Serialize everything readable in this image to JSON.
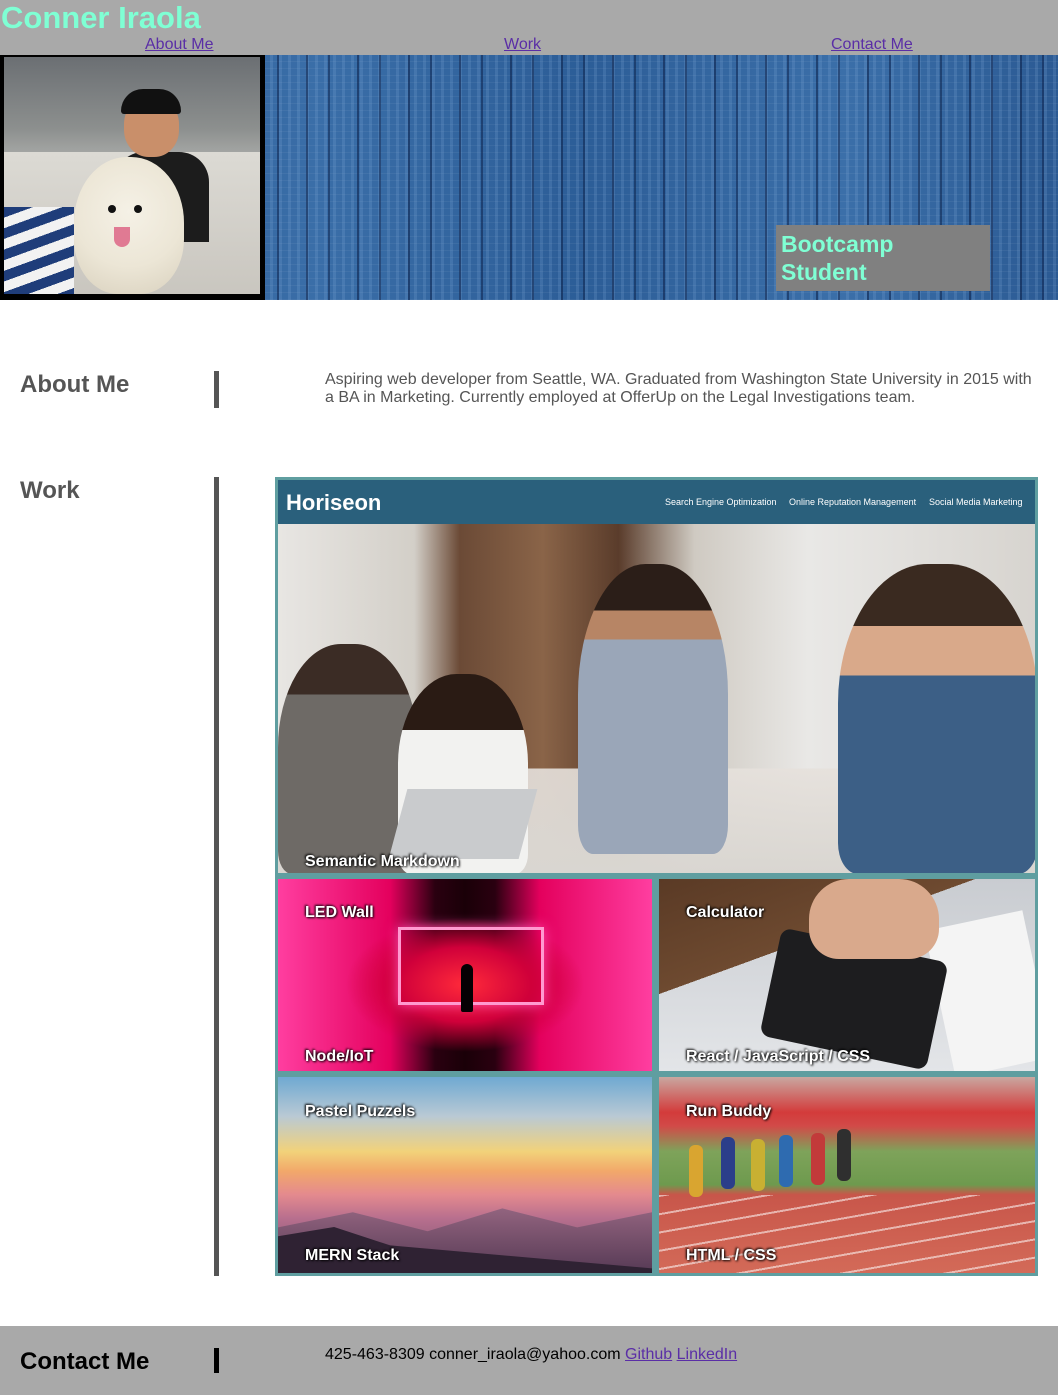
{
  "header": {
    "title": "Conner Iraola",
    "nav": [
      "About Me",
      "Work",
      "Contact Me"
    ],
    "title_color": "#7fffd4",
    "background": "#a9a9a9"
  },
  "hero": {
    "tagline": "Bootcamp Student",
    "tagline_color": "#7fffd4"
  },
  "about": {
    "heading": "About Me",
    "text": "Aspiring web developer from Seattle, WA. Graduated from Washington State University in 2015 with a BA in Marketing. Currently employed at OfferUp on the Legal Investigations team."
  },
  "work": {
    "heading": "Work",
    "featured": {
      "logo": "Horiseon",
      "nav": [
        "Search Engine Optimization",
        "Online Reputation Management",
        "Social Media Marketing"
      ],
      "caption": "Semantic Markdown"
    },
    "projects": [
      {
        "title": "LED Wall",
        "tech": "Node/IoT"
      },
      {
        "title": "Calculator",
        "tech": "React / JavaScript / CSS"
      },
      {
        "title": "Pastel Puzzels",
        "tech": "MERN Stack"
      },
      {
        "title": "Run Buddy",
        "tech": "HTML / CSS"
      }
    ],
    "accent_color": "#5f9ea0"
  },
  "footer": {
    "heading": "Contact Me",
    "phone": "425-463-8309",
    "email": "conner_iraola@yahoo.com",
    "links": [
      "Github",
      "LinkedIn"
    ]
  },
  "icons": [
    "profile-photo"
  ]
}
